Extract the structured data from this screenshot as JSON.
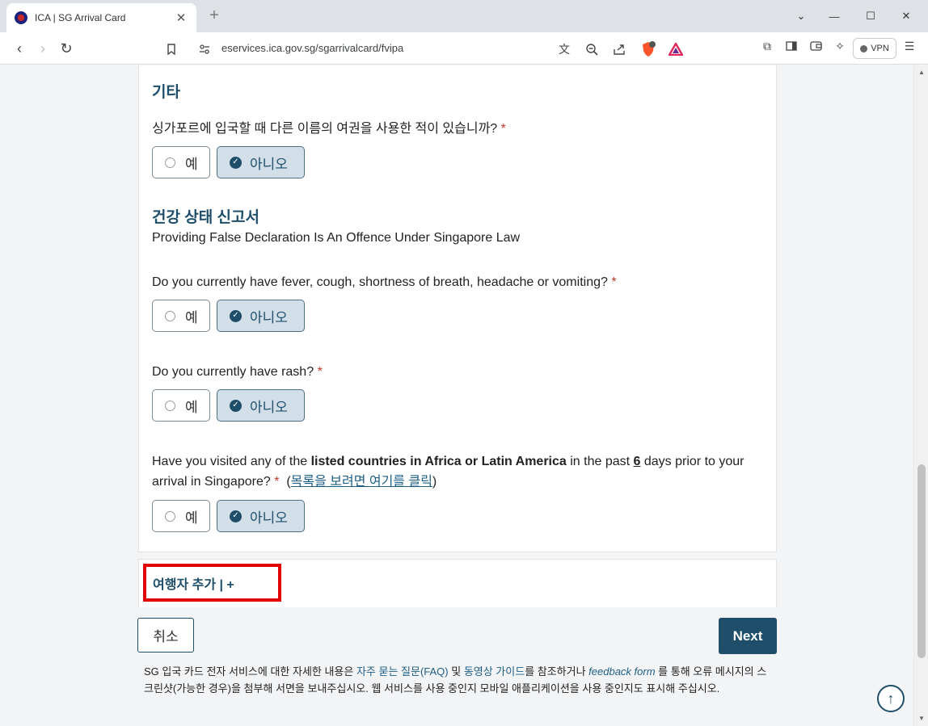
{
  "browser": {
    "tab_title": "ICA | SG Arrival Card",
    "tab_close": "✕",
    "new_tab": "+",
    "url": "eservices.ica.gov.sg/sgarrivalcard/fvipa",
    "vpn_label": "VPN",
    "brave_badge": "1",
    "icons": [
      "back-icon",
      "forward-icon",
      "reload-icon",
      "bookmark-icon",
      "site-settings-icon",
      "translate-icon",
      "zoom-icon",
      "share-icon",
      "brave-shields-icon",
      "brave-rewards-icon",
      "extensions-icon",
      "sidebar-icon",
      "wallet-icon",
      "leo-icon",
      "menu-icon"
    ]
  },
  "other": {
    "title": "기타",
    "question": "싱가포르에 입국할 때 다른 이름의 여권을 사용한 적이 있습니까?",
    "required": "*",
    "yes": "예",
    "no": "아니오",
    "selected": "no"
  },
  "health": {
    "title": "건강 상태 신고서",
    "subtitle": "Providing False Declaration Is An Offence Under Singapore Law",
    "q1": "Do you currently have fever, cough, shortness of breath, headache or vomiting?",
    "q2": "Do you currently have rash?",
    "q3_part1": "Have you visited any of the ",
    "q3_bold": "listed countries in Africa or Latin America",
    "q3_part2": " in the past ",
    "q3_days": "6",
    "q3_part3": " days prior to your arrival in Singapore?",
    "q3_link": "목록을 보려면 여기를 클릭",
    "yes": "예",
    "no": "아니오"
  },
  "add_traveller": "여행자 추가 | +",
  "buttons": {
    "cancel": "취소",
    "next": "Next"
  },
  "footer": {
    "part1": "SG 입국 카드 전자 서비스에 대한 자세한 내용은 ",
    "faq_link": "자주 묻는 질문(FAQ)",
    "part2": " 및 ",
    "video_link": "동영상 가이드",
    "part3": "를 참조하거나 ",
    "feedback_link": "feedback form",
    "part4": " 를 통해 오류 메시지의 스크린샷(가능한 경우)을 첨부해 서면을 보내주십시오. 웹 서비스를 사용 중인지 모바일 애플리케이션을 사용 중인지도 표시해 주십시오."
  },
  "colors": {
    "accent": "#1e4e6a",
    "highlight_box": "#e30000",
    "required": "#c0392b"
  }
}
